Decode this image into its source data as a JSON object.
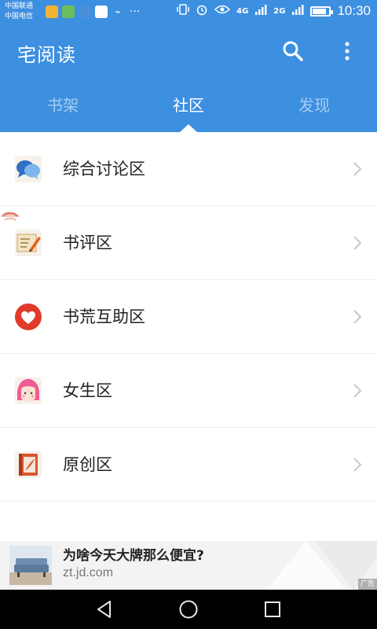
{
  "status_bar": {
    "carrier_1": "中国联通",
    "carrier_2": "中国电信",
    "network_1": "4G",
    "network_2": "2G",
    "time": "10:30",
    "battery_fraction": 0.75,
    "icons": [
      "app-notification-icon",
      "app-notification-icon",
      "app-notification-icon",
      "baidu-icon",
      "bird-icon",
      "more-notifications-icon",
      "vibrate-icon",
      "alarm-icon",
      "eye-icon",
      "signal-icon",
      "battery-icon"
    ]
  },
  "header": {
    "title": "宅阅读",
    "color": "#3d8fe0",
    "icons": [
      "search-icon",
      "more-vertical-icon"
    ]
  },
  "tabs": [
    {
      "label": "书架",
      "active": false
    },
    {
      "label": "社区",
      "active": true
    },
    {
      "label": "发现",
      "active": false
    }
  ],
  "list": [
    {
      "label": "综合讨论区",
      "icon": "chat-bubbles-icon"
    },
    {
      "label": "书评区",
      "icon": "note-pencil-icon"
    },
    {
      "label": "书荒互助区",
      "icon": "heart-icon"
    },
    {
      "label": "女生区",
      "icon": "girl-face-icon"
    },
    {
      "label": "原创区",
      "icon": "book-quill-icon"
    }
  ],
  "ad": {
    "title": "为啥今天大牌那么便宜?",
    "domain": "zt.jd.com",
    "badge": "广告"
  },
  "nav": {
    "icons": [
      "back-icon",
      "home-icon",
      "recents-icon"
    ]
  }
}
